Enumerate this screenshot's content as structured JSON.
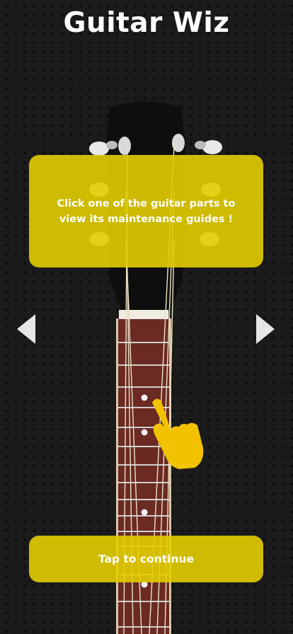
{
  "header": {
    "title": "Guitar Wiz"
  },
  "instruction": {
    "text": "Click one of the guitar parts to view its maintenance guides !"
  },
  "navigation": {
    "previous_icon": "chevron-left-icon",
    "next_icon": "chevron-right-icon"
  },
  "pointer": {
    "icon": "pointing-hand-icon"
  },
  "continue": {
    "label": "Tap to continue"
  },
  "colors": {
    "accent": "#E2CD00",
    "background": "#1B1B1B",
    "fretboard": "#6B2A22",
    "headstock": "#0E0E0E",
    "text": "#FFFFFF",
    "hand": "#F2C200"
  }
}
